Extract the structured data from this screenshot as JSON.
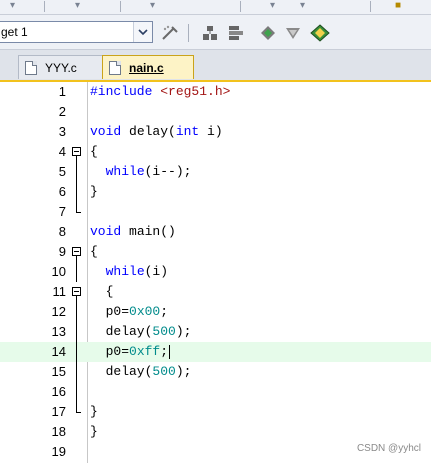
{
  "target": {
    "name": "get 1"
  },
  "tabs": [
    {
      "label": "YYY.c",
      "active": false
    },
    {
      "label": "nain.c",
      "active": true
    }
  ],
  "editor": {
    "current_line": 14,
    "lines": [
      {
        "n": "1",
        "tokens": [
          {
            "t": "#include ",
            "c": "kw"
          },
          {
            "t": "<reg51.h>",
            "c": "str"
          }
        ]
      },
      {
        "n": "2",
        "tokens": []
      },
      {
        "n": "3",
        "tokens": [
          {
            "t": "void ",
            "c": "kw"
          },
          {
            "t": "delay(",
            "c": "plain"
          },
          {
            "t": "int",
            "c": "kw"
          },
          {
            "t": " i)",
            "c": "plain"
          }
        ]
      },
      {
        "n": "4",
        "tokens": [
          {
            "t": "{",
            "c": "plain"
          }
        ]
      },
      {
        "n": "5",
        "tokens": [
          {
            "t": "  ",
            "c": "plain"
          },
          {
            "t": "while",
            "c": "kw"
          },
          {
            "t": "(i--);",
            "c": "plain"
          }
        ]
      },
      {
        "n": "6",
        "tokens": [
          {
            "t": "}",
            "c": "plain"
          }
        ]
      },
      {
        "n": "7",
        "tokens": []
      },
      {
        "n": "8",
        "tokens": [
          {
            "t": "void ",
            "c": "kw"
          },
          {
            "t": "main()",
            "c": "plain"
          }
        ]
      },
      {
        "n": "9",
        "tokens": [
          {
            "t": "{",
            "c": "plain"
          }
        ]
      },
      {
        "n": "10",
        "tokens": [
          {
            "t": "  ",
            "c": "plain"
          },
          {
            "t": "while",
            "c": "kw"
          },
          {
            "t": "(i)",
            "c": "plain"
          }
        ]
      },
      {
        "n": "11",
        "tokens": [
          {
            "t": "  {",
            "c": "plain"
          }
        ]
      },
      {
        "n": "12",
        "tokens": [
          {
            "t": "  p0=",
            "c": "plain"
          },
          {
            "t": "0x00",
            "c": "num"
          },
          {
            "t": ";",
            "c": "plain"
          }
        ]
      },
      {
        "n": "13",
        "tokens": [
          {
            "t": "  delay(",
            "c": "plain"
          },
          {
            "t": "500",
            "c": "num"
          },
          {
            "t": ");",
            "c": "plain"
          }
        ]
      },
      {
        "n": "14",
        "tokens": [
          {
            "t": "  p0=",
            "c": "plain"
          },
          {
            "t": "0xff",
            "c": "num"
          },
          {
            "t": ";",
            "c": "plain"
          }
        ]
      },
      {
        "n": "15",
        "tokens": [
          {
            "t": "  delay(",
            "c": "plain"
          },
          {
            "t": "500",
            "c": "num"
          },
          {
            "t": ");",
            "c": "plain"
          }
        ]
      },
      {
        "n": "16",
        "tokens": []
      },
      {
        "n": "17",
        "tokens": [
          {
            "t": "}",
            "c": "plain"
          }
        ]
      },
      {
        "n": "18",
        "tokens": [
          {
            "t": "}",
            "c": "plain"
          }
        ]
      },
      {
        "n": "19",
        "tokens": []
      }
    ]
  },
  "watermark": "CSDN @yyhcl",
  "colors": {
    "tab_accent": "#f2c21d",
    "current_line": "#e6fbea",
    "keyword": "#0000ff",
    "number": "#008b8b",
    "string": "#a31515"
  }
}
